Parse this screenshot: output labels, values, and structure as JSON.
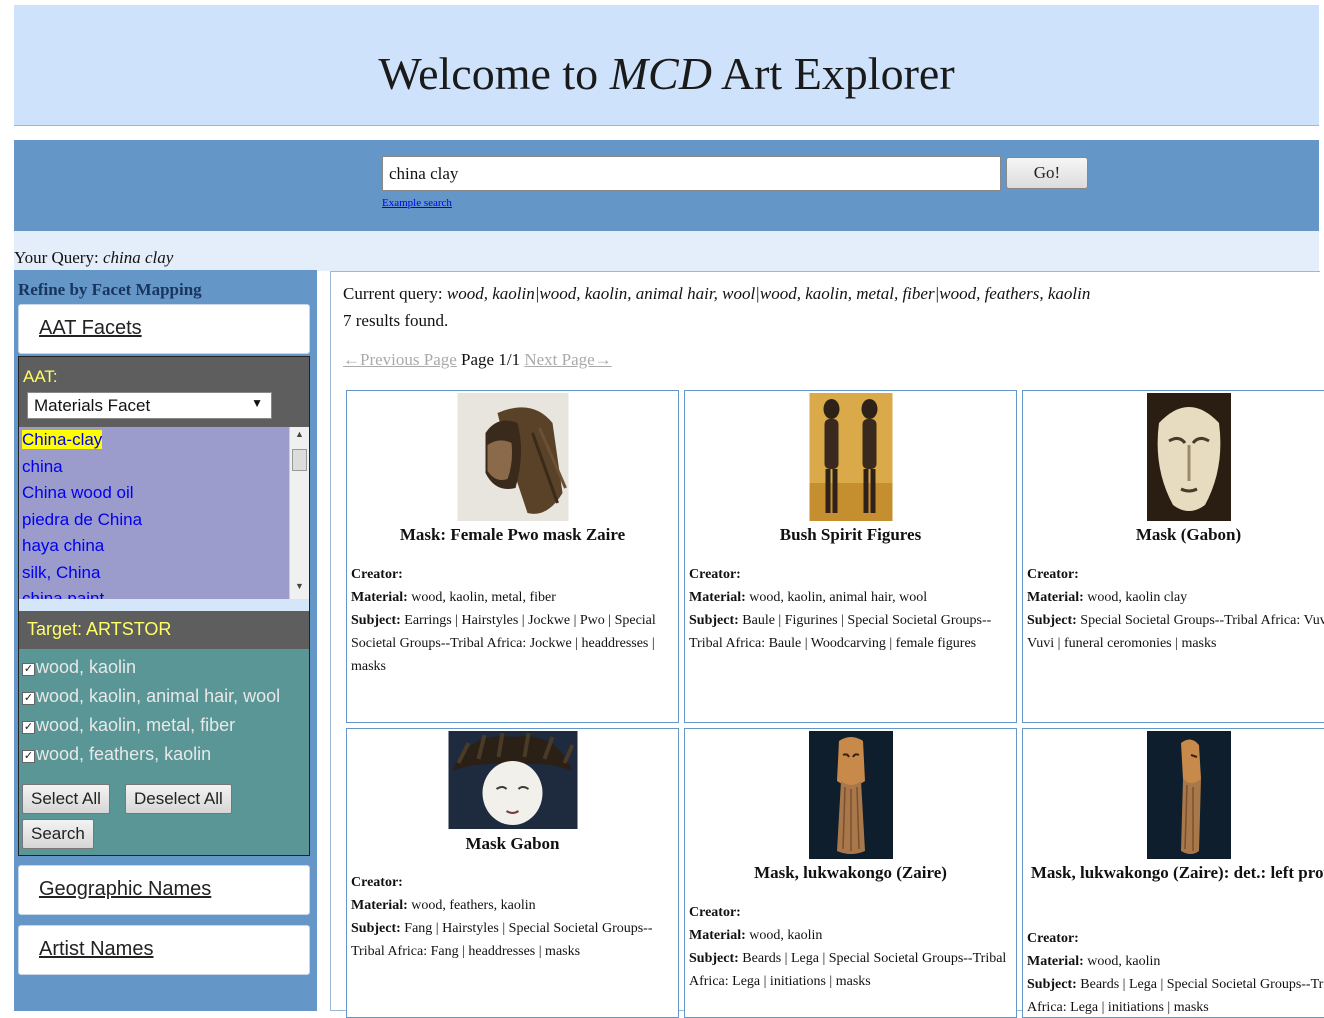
{
  "header": {
    "title_pre": "Welcome to ",
    "title_em": "MCD",
    "title_post": " Art Explorer"
  },
  "search": {
    "value": "china clay",
    "go_label": "Go!",
    "example_link": "Example search"
  },
  "your_query": {
    "label": "Your Query: ",
    "value": "china clay"
  },
  "sidebar": {
    "refine_label": "Refine by Facet Mapping",
    "aat_facets": "AAT Facets",
    "aat_label": "AAT:",
    "aat_selected": "Materials Facet",
    "terms": [
      "China-clay",
      "china",
      "China wood oil",
      "piedra de China",
      "haya china",
      "silk, China",
      "china paint"
    ],
    "target_label": "Target: ARTSTOR",
    "checks": [
      "wood, kaolin",
      "wood, kaolin, animal hair, wool",
      "wood, kaolin, metal, fiber",
      "wood, feathers, kaolin"
    ],
    "select_all": "Select All",
    "deselect_all": "Deselect All",
    "search_button": "Search",
    "geographic_names": "Geographic Names",
    "artist_names": "Artist Names"
  },
  "results": {
    "current_query_label": "Current query: ",
    "current_query": "wood, kaolin|wood, kaolin, animal hair, wool|wood, kaolin, metal, fiber|wood, feathers, kaolin",
    "count_text": "7 results found.",
    "prev": "←Previous Page",
    "page": " Page 1/1 ",
    "next": "Next Page→",
    "creator_label": "Creator:",
    "material_label": "Material:",
    "subject_label": "Subject:",
    "items": [
      {
        "title": "Mask: Female Pwo mask Zaire",
        "material": "wood, kaolin, metal, fiber",
        "subject": "Earrings | Hairstyles | Jockwe | Pwo | Special Societal Groups--Tribal Africa: Jockwe | headdresses | masks"
      },
      {
        "title": "Bush Spirit Figures",
        "material": "wood, kaolin, animal hair, wool",
        "subject": "Baule | Figurines | Special Societal Groups--Tribal Africa: Baule | Woodcarving | female figures"
      },
      {
        "title": "Mask (Gabon)",
        "material": "wood, kaolin clay",
        "subject": "Special Societal Groups--Tribal Africa: Vuvi | Vuvi | funeral ceromonies | masks"
      },
      {
        "title": "Mask Gabon",
        "material": "wood, feathers, kaolin",
        "subject": "Fang | Hairstyles | Special Societal Groups--Tribal Africa: Fang | headdresses | masks"
      },
      {
        "title": "Mask, lukwakongo (Zaire)",
        "material": "wood, kaolin",
        "subject": "Beards | Lega | Special Societal Groups--Tribal Africa: Lega | initiations | masks"
      },
      {
        "title": "Mask, lukwakongo (Zaire): det.: left profile",
        "material": "wood, kaolin",
        "subject": "Beards | Lega | Special Societal Groups--Tribal Africa: Lega | initiations | masks"
      }
    ]
  }
}
